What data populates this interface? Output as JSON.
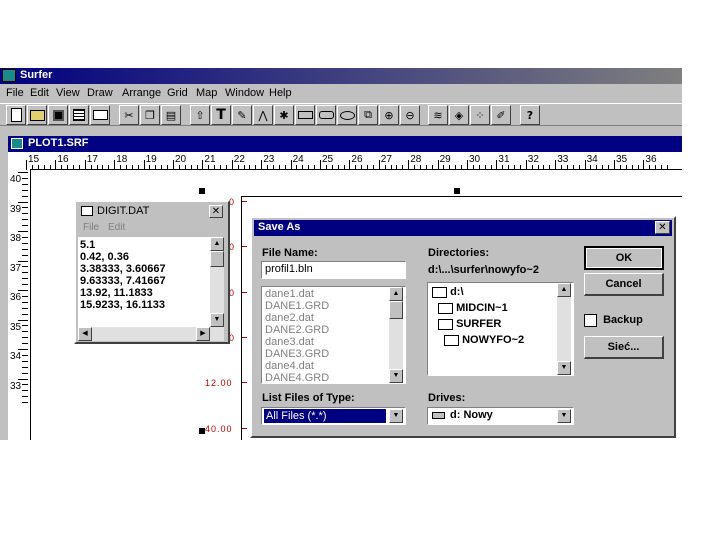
{
  "app": {
    "title": "Surfer",
    "menu": [
      "File",
      "Edit",
      "View",
      "Draw",
      "Arrange",
      "Grid",
      "Map",
      "Window",
      "Help"
    ],
    "toolbar_icons": [
      "new-icon",
      "open-icon",
      "save-icon",
      "grid-icon",
      "print-icon",
      "cut-icon",
      "copy-icon",
      "paste-icon",
      "pointer-icon",
      "text-icon",
      "draw-icon",
      "polyline-icon",
      "symbol-icon",
      "rectangle-icon",
      "rounded-rect-icon",
      "ellipse-icon",
      "reshape-icon",
      "zoom-in-icon",
      "zoom-out-icon",
      "contour-map-icon",
      "surface-map-icon",
      "post-map-icon",
      "digitize-icon",
      "help-icon"
    ],
    "text_glyph": "T",
    "help_glyph": "?"
  },
  "plot": {
    "title": "PLOT1.SRF",
    "ruler_top": [
      "15",
      "16",
      "17",
      "18",
      "19",
      "20",
      "21",
      "22",
      "23",
      "24",
      "25",
      "26",
      "27",
      "28",
      "29",
      "30",
      "31",
      "32",
      "33",
      "34",
      "35",
      "36"
    ],
    "ruler_left": [
      "40",
      "39",
      "38",
      "37",
      "36",
      "35",
      "34",
      "33"
    ],
    "axis_labels": [
      "0",
      "0",
      "0",
      "0",
      "12.00",
      "40.00"
    ]
  },
  "digit": {
    "title": "DIGIT.DAT",
    "menu": [
      "File",
      "Edit"
    ],
    "lines": [
      "5.1",
      "0.42, 0.36",
      "3.38333, 3.60667",
      "9.63333, 7.41667",
      "13.92, 11.1833",
      "15.9233, 16.1133"
    ]
  },
  "save_as": {
    "title": "Save As",
    "file_name_label": "File Name:",
    "file_name_value": "profil1.bln",
    "files": [
      "dane1.dat",
      "DANE1.GRD",
      "dane2.dat",
      "DANE2.GRD",
      "dane3.dat",
      "DANE3.GRD",
      "dane4.dat",
      "DANE4.GRD"
    ],
    "directories_label": "Directories:",
    "current_dir": "d:\\...\\surfer\\nowyfo~2",
    "dir_tree": [
      "d:\\",
      "MIDCIN~1",
      "SURFER",
      "NOWYFO~2"
    ],
    "list_type_label": "List Files of Type:",
    "list_type_value": "All Files (*.*)",
    "drives_label": "Drives:",
    "drive_value": "d: Nowy",
    "ok": "OK",
    "cancel": "Cancel",
    "backup": "Backup",
    "network": "Sieć..."
  },
  "colors": {
    "title_bar": "#000080",
    "list_selection": "#000080",
    "axis_labels": "#c00000",
    "window_gray": "#c0c0c0"
  }
}
